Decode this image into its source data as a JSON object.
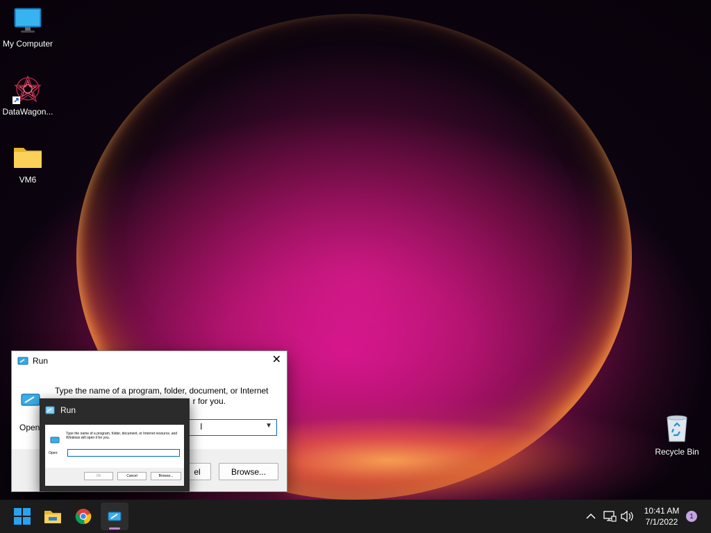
{
  "desktop": {
    "icons": [
      {
        "label": "My Computer",
        "icon": "monitor-icon"
      },
      {
        "label": "DataWagon...",
        "icon": "datawagon-app-icon"
      },
      {
        "label": "VM6",
        "icon": "folder-icon"
      },
      {
        "label": "Recycle Bin",
        "icon": "recycle-bin-icon"
      }
    ]
  },
  "run_dialog": {
    "title": "Run",
    "description": "Type the name of a program, folder, document, or Internet resource, and Windows will open it for you.",
    "visible_description_line1": "Type the name of a program, folder, document, or Internet",
    "visible_description_line2": "r for you.",
    "open_label": "Open:",
    "open_label_visible": "Open",
    "open_value": "",
    "cancel_label_visible": "el",
    "browse_label": "Browse..."
  },
  "preview": {
    "title": "Run",
    "thumb": {
      "description": "Type the name of a program, folder, document, or Internet resource, and Windows will open it for you.",
      "open_label": "Open:",
      "ok_label": "OK",
      "cancel_label": "Cancel",
      "browse_label": "Browse..."
    }
  },
  "taskbar": {
    "apps": [
      "start-icon",
      "file-explorer-icon",
      "chrome-icon",
      "run-app-icon"
    ],
    "tray": [
      "chevron-up-icon",
      "network-icon",
      "volume-icon"
    ],
    "time": "10:41 AM",
    "date": "7/1/2022",
    "notification_count": "1"
  },
  "colors": {
    "taskbar": "#1c1c1c",
    "accent": "#0067c0",
    "notification_badge": "#c5a3e6"
  }
}
